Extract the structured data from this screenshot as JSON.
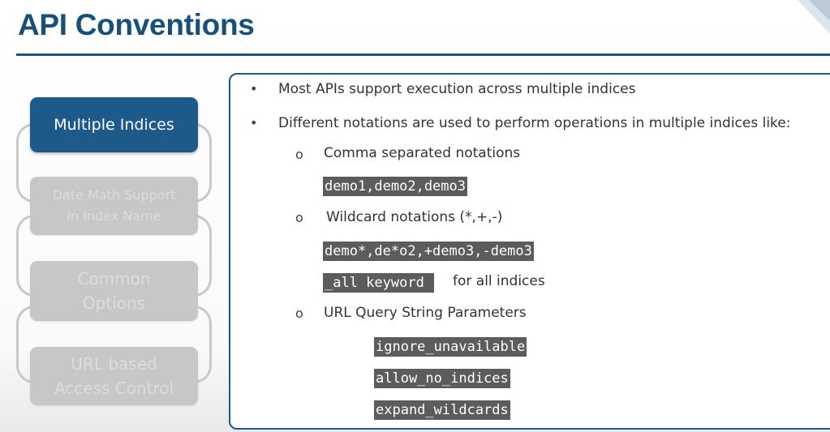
{
  "header": {
    "title": "API Conventions"
  },
  "sidebar": {
    "steps": [
      {
        "label": "Multiple Indices",
        "active": true
      },
      {
        "label_line1": "Date Math Support",
        "label_line2": "in Index Name",
        "active": false
      },
      {
        "label_line1": "Common",
        "label_line2": "Options",
        "active": false
      },
      {
        "label_line1": "URL based",
        "label_line2": "Access Control",
        "active": false
      }
    ]
  },
  "content": {
    "bullet1": "Most APIs support execution across multiple indices",
    "bullet2": "Different notations are used to perform operations in multiple indices like:",
    "bullet_marker": "•",
    "sub_marker": "o",
    "comma": {
      "label": "Comma separated notations",
      "code": "demo1,demo2,demo3"
    },
    "wildcard": {
      "label": "Wildcard notations (*,+,-)",
      "code": "demo*,de*o2,+demo3,-demo3",
      "all_code": "_all keyword ",
      "all_text": "for all indices"
    },
    "url": {
      "label": "URL Query String Parameters",
      "params": [
        "ignore_unavailable",
        "allow_no_indices",
        "expand_wildcards"
      ]
    }
  },
  "colors": {
    "accent": "#1e5a89",
    "title": "#17507a",
    "inactive": "#c7c7c7",
    "code_bg": "#5c5c5c"
  }
}
